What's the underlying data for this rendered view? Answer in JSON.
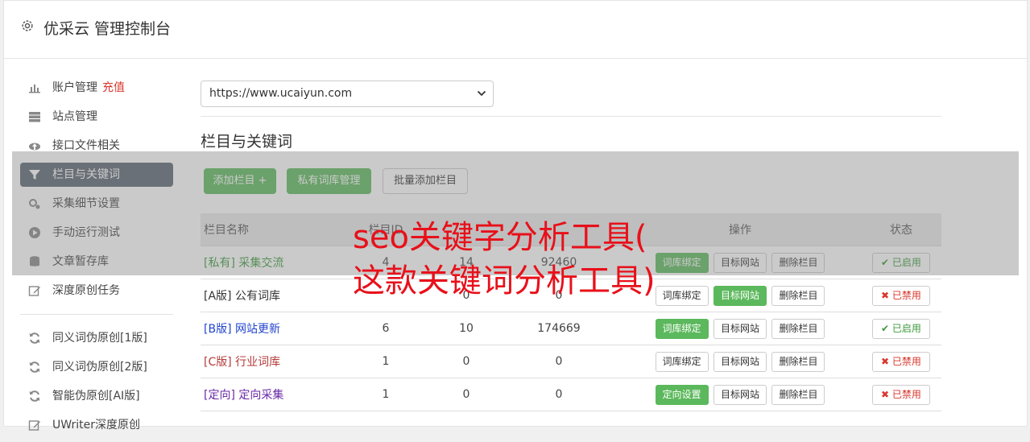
{
  "header": {
    "title": "优采云 管理控制台"
  },
  "sidebar": {
    "items": [
      {
        "label": "账户管理",
        "badge": "充值",
        "icon": "bar-chart-icon"
      },
      {
        "label": "站点管理",
        "icon": "server-icon"
      },
      {
        "label": "接口文件相关",
        "icon": "cloud-upload-icon"
      },
      {
        "label": "栏目与关键词",
        "icon": "filter-icon"
      },
      {
        "label": "采集细节设置",
        "icon": "cogs-icon"
      },
      {
        "label": "手动运行测试",
        "icon": "play-circle-icon"
      },
      {
        "label": "文章暂存库",
        "icon": "database-icon"
      },
      {
        "label": "深度原创任务",
        "icon": "edit-icon"
      }
    ],
    "items2": [
      {
        "label": "同义词伪原创[1版]",
        "icon": "refresh-icon"
      },
      {
        "label": "同义词伪原创[2版]",
        "icon": "refresh-icon"
      },
      {
        "label": "智能伪原创[AI版]",
        "icon": "refresh-icon"
      },
      {
        "label": "UWriter深度原创",
        "icon": "edit-icon"
      }
    ]
  },
  "site_select": {
    "value": "https://www.ucaiyun.com"
  },
  "section": {
    "title": "栏目与关键词"
  },
  "toolbar": {
    "add": "添加栏目 +",
    "private_lib": "私有词库管理",
    "batch_add": "批量添加栏目"
  },
  "table": {
    "headers": [
      "栏目名称",
      "栏目ID",
      "",
      "",
      "操作",
      "状态"
    ],
    "rows": [
      {
        "tag": "[私有]",
        "name": "采集交流",
        "id": "4",
        "a": "14",
        "b": "92460",
        "act1": "词库绑定",
        "act2": "目标网站",
        "act3": "删除栏目",
        "status": "已启用"
      },
      {
        "tag": "[A版]",
        "name": "公有词库",
        "id": "",
        "a": "0",
        "b": "0",
        "act1": "词库绑定",
        "act2": "目标网站",
        "act3": "删除栏目",
        "status": "已禁用"
      },
      {
        "tag": "[B版]",
        "name": "网站更新",
        "id": "6",
        "a": "10",
        "b": "174669",
        "act1": "词库绑定",
        "act2": "目标网站",
        "act3": "删除栏目",
        "status": "已启用"
      },
      {
        "tag": "[C版]",
        "name": "行业词库",
        "id": "1",
        "a": "0",
        "b": "0",
        "act1": "词库绑定",
        "act2": "目标网站",
        "act3": "删除栏目",
        "status": "已禁用"
      },
      {
        "tag": "[定向]",
        "name": "定向采集",
        "id": "1",
        "a": "0",
        "b": "0",
        "act1": "定向设置",
        "act2": "目标网站",
        "act3": "删除栏目",
        "status": "已禁用"
      }
    ]
  },
  "overlay_text": {
    "line1": "seo关键字分析工具(",
    "line2": "这款关键词分析工具)"
  },
  "colors": {
    "green": "#5cb85c",
    "red": "#d9362c",
    "overlay_text": "#e8101a",
    "active_nav": "#5b6470"
  }
}
